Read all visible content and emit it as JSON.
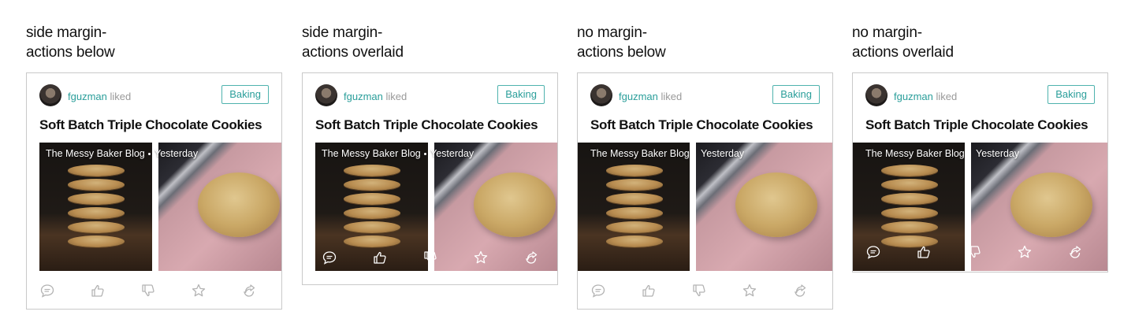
{
  "variants": [
    {
      "label_line1": "side margin-",
      "label_line2": "actions below"
    },
    {
      "label_line1": "side margin-",
      "label_line2": "actions overlaid"
    },
    {
      "label_line1": "no margin-",
      "label_line2": "actions below"
    },
    {
      "label_line1": "no margin-",
      "label_line2": "actions overlaid"
    }
  ],
  "card": {
    "username": "fguzman",
    "verb": "liked",
    "tag": "Baking",
    "title": "Soft Batch Triple Chocolate Cookies",
    "source": "The Messy Baker Blog",
    "time": "Yesterday"
  },
  "icons": [
    "comment-icon",
    "thumbs-up-icon",
    "thumbs-down-icon",
    "star-icon",
    "share-icon"
  ],
  "colors": {
    "accent": "#2a9e9a",
    "muted": "#999999",
    "icon_below": "#b3b3b3",
    "icon_overlaid": "#ffffff",
    "border": "#c9c9c9"
  }
}
